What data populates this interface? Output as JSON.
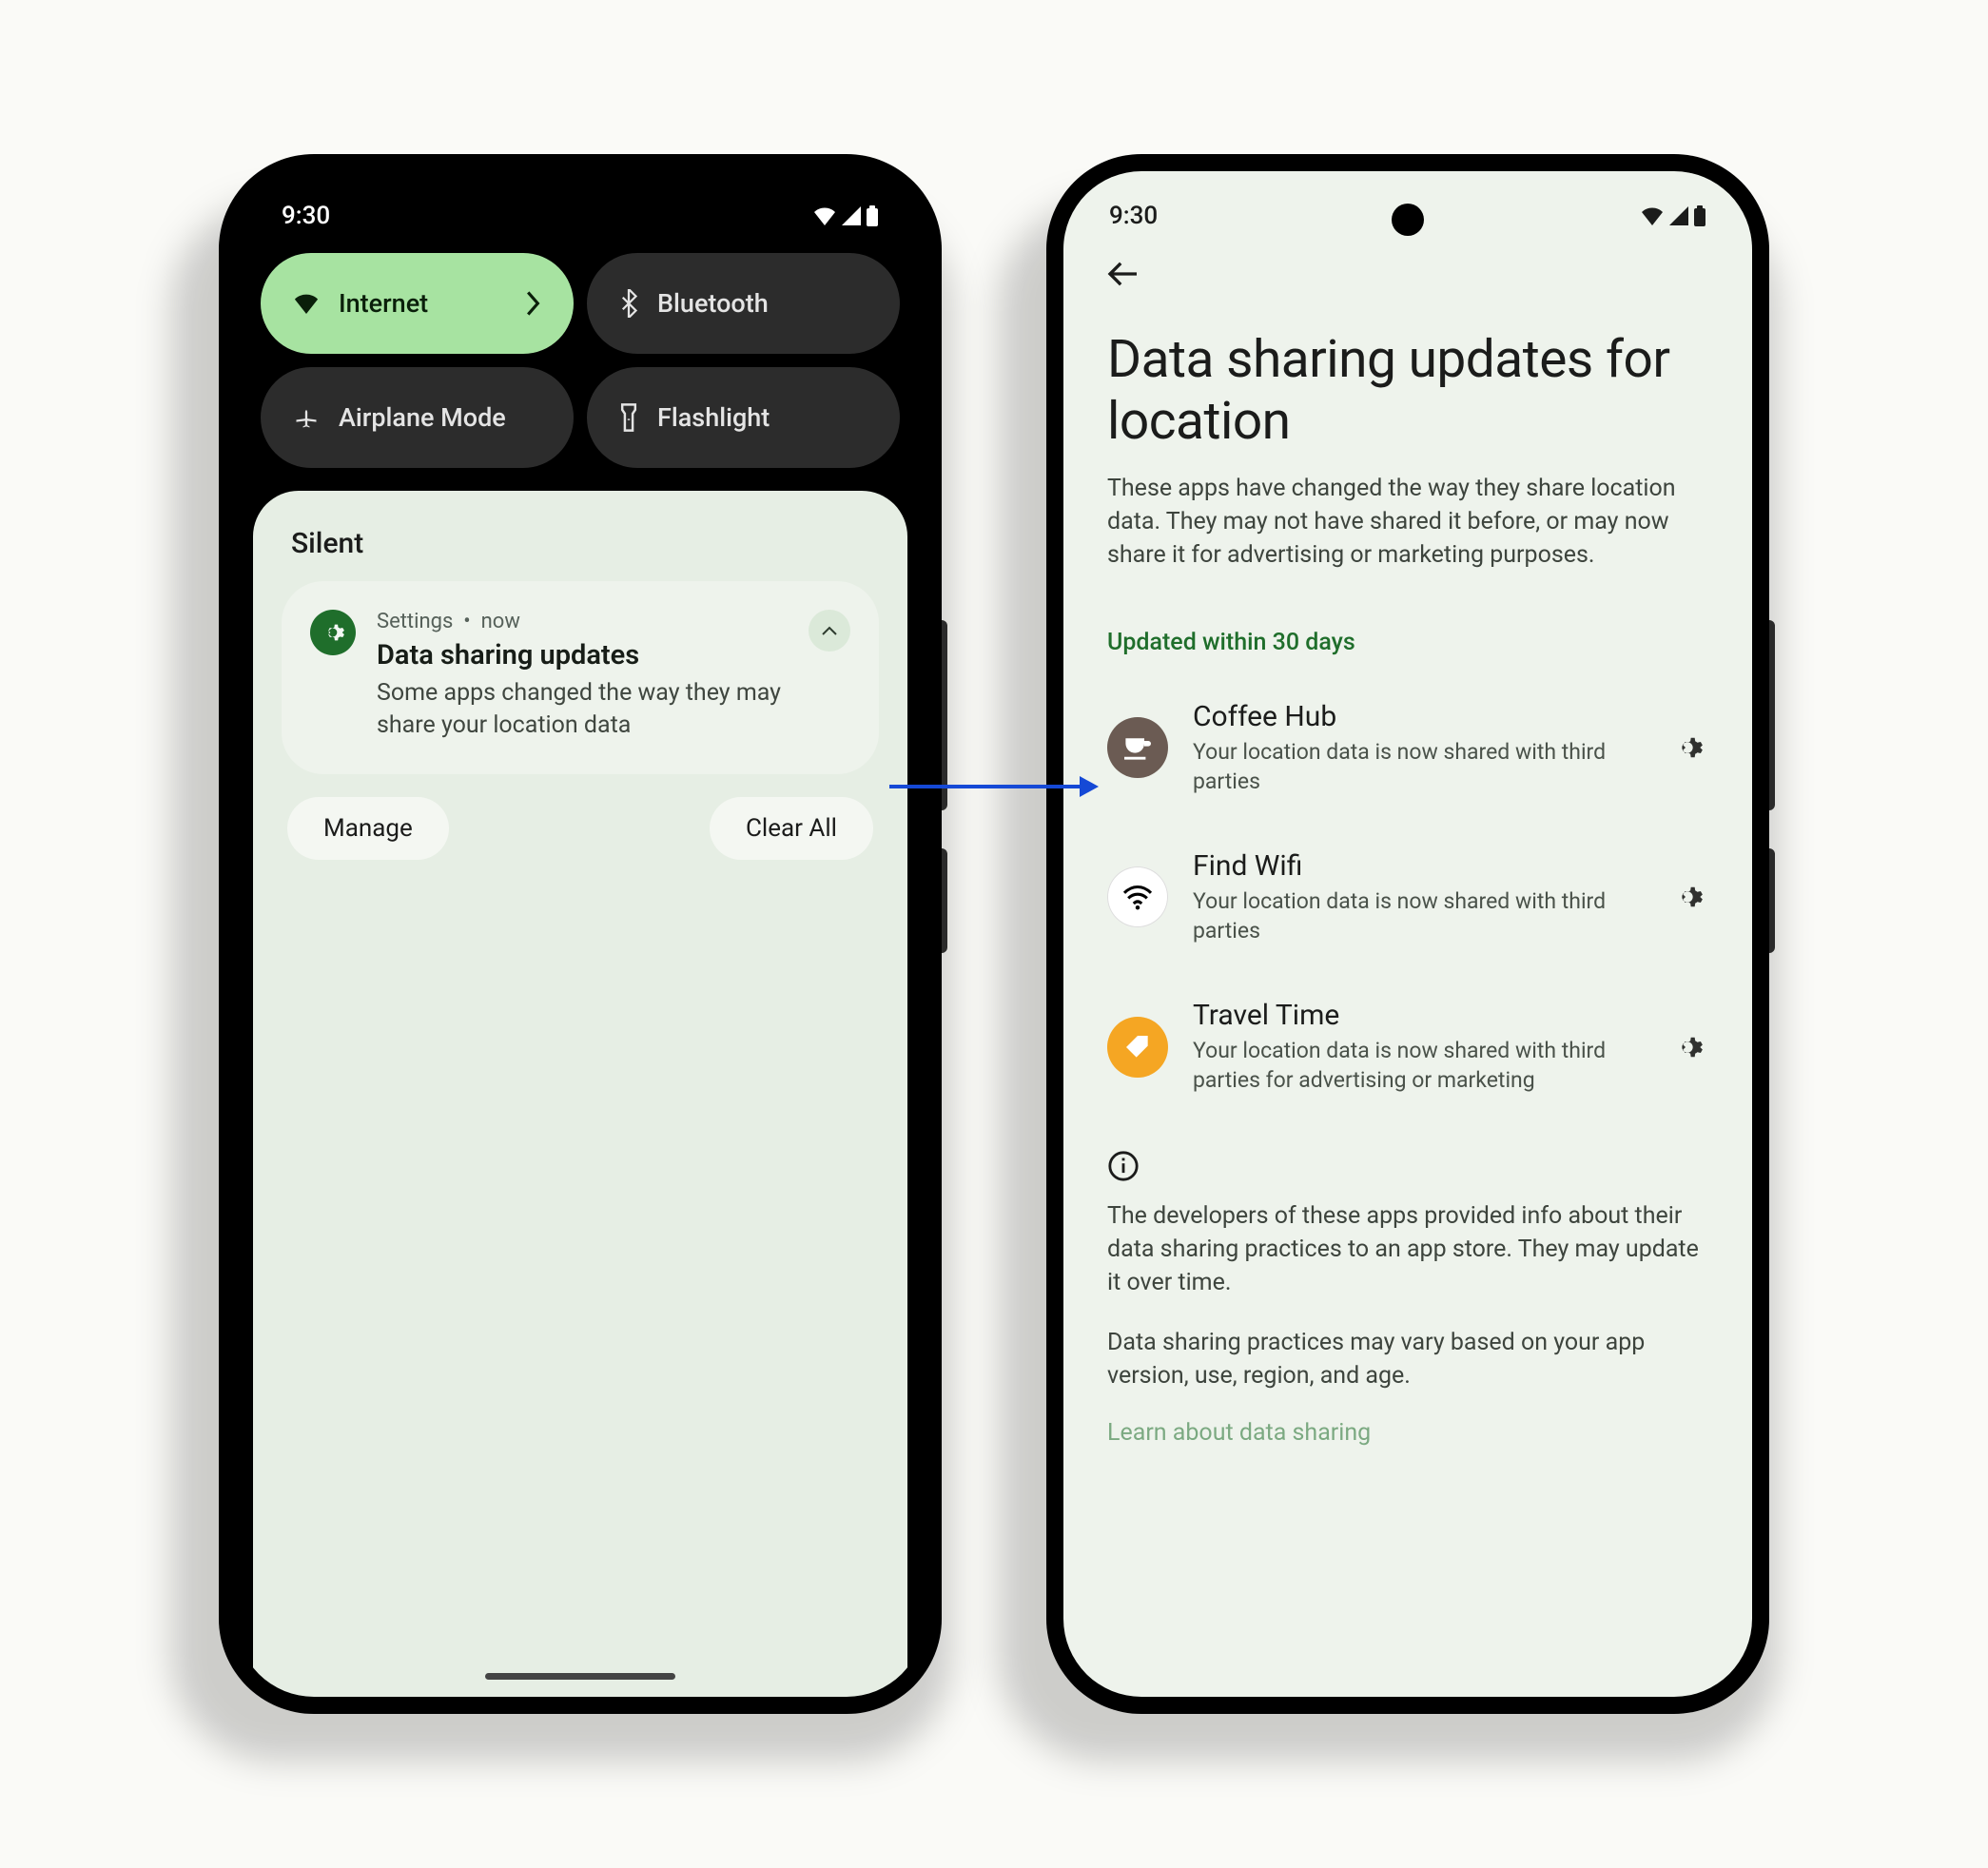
{
  "status": {
    "time": "9:30"
  },
  "qs": {
    "internet": {
      "label": "Internet"
    },
    "bluetooth": {
      "label": "Bluetooth"
    },
    "airplane": {
      "label": "Airplane Mode"
    },
    "flashlight": {
      "label": "Flashlight"
    }
  },
  "shade": {
    "heading": "Silent",
    "notif": {
      "source": "Settings",
      "sep": "•",
      "time": "now",
      "title": "Data sharing updates",
      "body": "Some apps changed the way they may share your location data"
    },
    "manage": "Manage",
    "clear": "Clear All"
  },
  "page": {
    "title": "Data sharing updates for location",
    "subtitle": "These apps have changed the way they share location data. They may not have shared it before, or may now share it for advertising or marketing purposes.",
    "section": "Updated within 30 days",
    "apps": [
      {
        "name": "Coffee Hub",
        "desc": "Your location data is now shared with third parties"
      },
      {
        "name": "Find Wifi",
        "desc": "Your location data is now shared with third parties"
      },
      {
        "name": "Travel Time",
        "desc": "Your location data is now shared with third parties for advertising or marketing"
      }
    ],
    "info1": "The developers of these apps provided info about their data sharing practices to an app store. They may update it over time.",
    "info2": "Data sharing practices may vary based on your app version, use, region, and age.",
    "learn": "Learn about data sharing"
  }
}
